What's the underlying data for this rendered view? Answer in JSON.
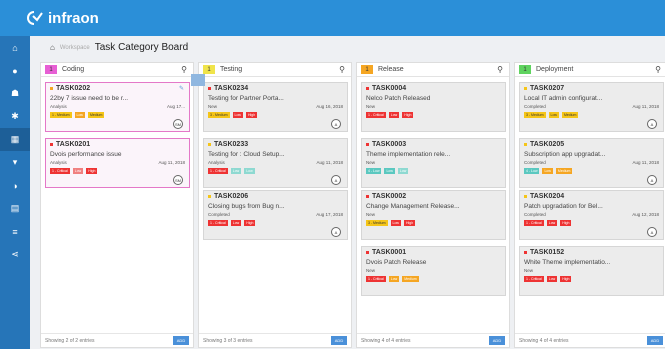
{
  "app": {
    "name": "infraon",
    "logo_icon": "infraon-logo-icon"
  },
  "sidebar": {
    "items": [
      {
        "icon": "home-icon",
        "glyph": "⌂"
      },
      {
        "icon": "user-icon",
        "glyph": "●"
      },
      {
        "icon": "users-icon",
        "glyph": "☗"
      },
      {
        "icon": "settings-icon",
        "glyph": "✱"
      },
      {
        "icon": "board-icon",
        "glyph": "▦",
        "active": true
      },
      {
        "icon": "filter-icon",
        "glyph": "▾"
      },
      {
        "icon": "gauge-icon",
        "glyph": "◑"
      },
      {
        "icon": "chart-icon",
        "glyph": "▤"
      },
      {
        "icon": "list-icon",
        "glyph": "≡"
      },
      {
        "icon": "share-icon",
        "glyph": "⋖"
      }
    ]
  },
  "breadcrumb": {
    "home_glyph": "⌂",
    "workspace": "Workspace",
    "title": "Task Category Board"
  },
  "columns": [
    {
      "badge": "1",
      "badge_color": "#e75fd4",
      "name": "Coding",
      "showing": "Showing 2 of 2 entries",
      "add": "ADD",
      "cards": [
        {
          "id": "TASK0202",
          "dot": "#f5a623",
          "title": "22by 7 issue need to be r...",
          "status": "Analysis",
          "date": "Aug 17...",
          "tags": [
            {
              "t": "1 - Medium",
              "c": "yellow"
            },
            {
              "t": "Low",
              "c": "orange"
            },
            {
              "t": "Medium",
              "c": "yellow"
            }
          ],
          "avatar": "SM",
          "style": "pink",
          "edit": true
        },
        {
          "id": "TASK0201",
          "dot": "#e33",
          "title": "Dvois performance issue",
          "status": "Analysis",
          "date": "Aug 11, 2018",
          "tags": [
            {
              "t": "1 - Critical",
              "c": "red"
            },
            {
              "t": "Low",
              "c": "lightred"
            },
            {
              "t": "High",
              "c": "red"
            }
          ],
          "avatar": "SM",
          "style": "pink",
          "edit": false
        }
      ]
    },
    {
      "badge": "1",
      "badge_color": "#f0e44a",
      "name": "Testing",
      "showing": "Showing 3 of 3 entries",
      "add": "ADD",
      "cards": [
        {
          "id": "TASK0234",
          "dot": "#e33",
          "title": "Testing for Partner Porta...",
          "status": "New",
          "date": "Aug 16, 2018",
          "tags": [
            {
              "t": "3 - Medium",
              "c": "yellow"
            },
            {
              "t": "Low",
              "c": "red"
            },
            {
              "t": "High",
              "c": "red"
            }
          ],
          "avatar": "A",
          "style": "gray"
        },
        {
          "id": "TASK0233",
          "dot": "#f5c518",
          "title": "Testing for : Cloud Setup...",
          "status": "Analysis",
          "date": "Aug 11, 2018",
          "tags": [
            {
              "t": "1 - Critical",
              "c": "red"
            },
            {
              "t": "Low",
              "c": "lightteal"
            },
            {
              "t": "Low",
              "c": "lightteal"
            }
          ],
          "avatar": "A",
          "style": "gray"
        },
        {
          "id": "TASK0206",
          "dot": "#f5c518",
          "title": "Closing bugs from Bug n...",
          "status": "Completed",
          "date": "Aug 17, 2018",
          "tags": [
            {
              "t": "1 - Critical",
              "c": "red"
            },
            {
              "t": "Low",
              "c": "red"
            },
            {
              "t": "High",
              "c": "red"
            }
          ],
          "avatar": "A",
          "style": "gray"
        }
      ]
    },
    {
      "badge": "1",
      "badge_color": "#f5a623",
      "name": "Release",
      "showing": "Showing 4 of 4 entries",
      "add": "ADD",
      "cards": [
        {
          "id": "TASK0004",
          "dot": "#e33",
          "title": "Nelco Patch Released",
          "status": "New",
          "date": "",
          "tags": [
            {
              "t": "1 - Critical",
              "c": "red"
            },
            {
              "t": "Low",
              "c": "red"
            },
            {
              "t": "High",
              "c": "red"
            }
          ],
          "style": "gray"
        },
        {
          "id": "TASK0003",
          "dot": "#e33",
          "title": "Theme implementation rele...",
          "status": "New",
          "date": "",
          "tags": [
            {
              "t": "4 - Low",
              "c": "teal"
            },
            {
              "t": "Low",
              "c": "teal"
            },
            {
              "t": "Low",
              "c": "lightteal"
            }
          ],
          "style": "gray"
        },
        {
          "id": "TASK0002",
          "dot": "#e33",
          "title": "Change Management Release...",
          "status": "New",
          "date": "",
          "tags": [
            {
              "t": "3 - Medium",
              "c": "yellow"
            },
            {
              "t": "Low",
              "c": "red"
            },
            {
              "t": "High",
              "c": "red"
            }
          ],
          "style": "gray"
        },
        {
          "id": "TASK0001",
          "dot": "#e33",
          "title": "Dvois Patch Release",
          "status": "New",
          "date": "",
          "tags": [
            {
              "t": "1 - Critical",
              "c": "red"
            },
            {
              "t": "Low",
              "c": "orange"
            },
            {
              "t": "Medium",
              "c": "orange"
            }
          ],
          "style": "gray"
        }
      ]
    },
    {
      "badge": "1",
      "badge_color": "#5fd35f",
      "name": "Deployment",
      "showing": "Showing 4 of 4 entries",
      "add": "ADD",
      "cards": [
        {
          "id": "TASK0207",
          "dot": "#f5c518",
          "title": "Local IT admin configurat...",
          "status": "Completed",
          "date": "Aug 11, 2018",
          "tags": [
            {
              "t": "3 - Medium",
              "c": "yellow"
            },
            {
              "t": "Low",
              "c": "yellow"
            },
            {
              "t": "Medium",
              "c": "yellow"
            }
          ],
          "avatar": "A",
          "style": "gray"
        },
        {
          "id": "TASK0205",
          "dot": "#f5c518",
          "title": "Subscription app upgradat...",
          "status": "Completed",
          "date": "Aug 11, 2018",
          "tags": [
            {
              "t": "4 - Low",
              "c": "teal"
            },
            {
              "t": "Low",
              "c": "orange"
            },
            {
              "t": "Medium",
              "c": "orange"
            }
          ],
          "avatar": "A",
          "style": "gray"
        },
        {
          "id": "TASK0204",
          "dot": "#f5c518",
          "title": "Patch upgradation for Bel...",
          "status": "Completed",
          "date": "Aug 12, 2018",
          "tags": [
            {
              "t": "1 - Critical",
              "c": "red"
            },
            {
              "t": "Low",
              "c": "red"
            },
            {
              "t": "High",
              "c": "red"
            }
          ],
          "avatar": "A",
          "style": "gray"
        },
        {
          "id": "TASK0152",
          "dot": "#e33",
          "title": "White Theme implementatio...",
          "status": "New",
          "date": "",
          "tags": [
            {
              "t": "1 - Critical",
              "c": "red"
            },
            {
              "t": "Low",
              "c": "red"
            },
            {
              "t": "High",
              "c": "red"
            }
          ],
          "style": "gray"
        }
      ]
    }
  ]
}
